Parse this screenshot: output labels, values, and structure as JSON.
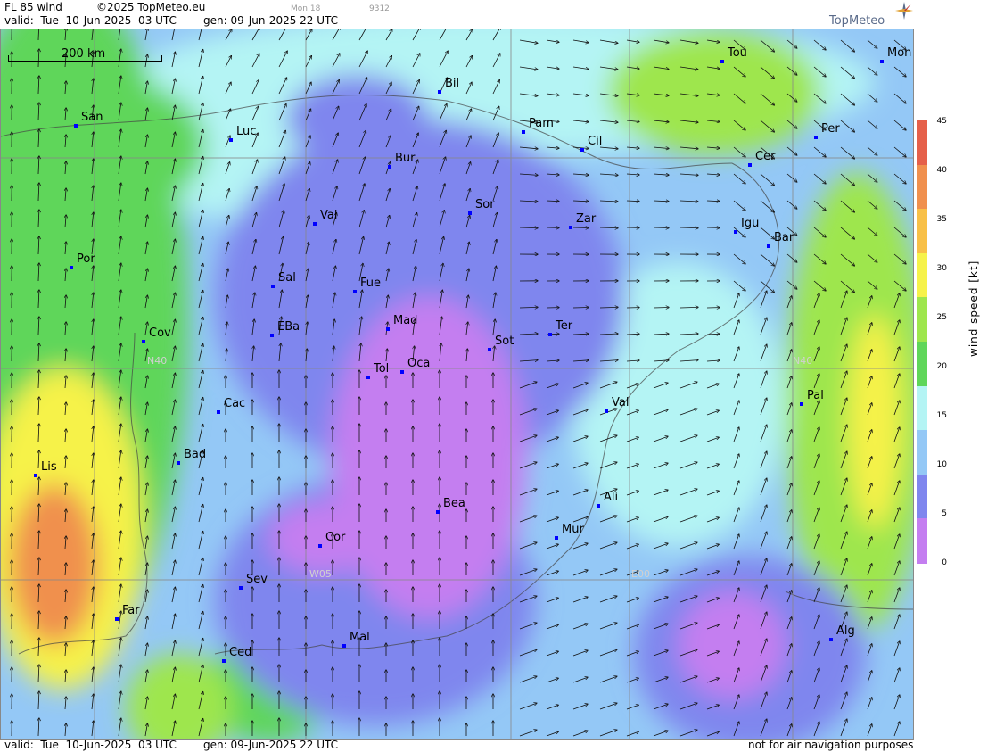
{
  "header": {
    "title": "FL 85 wind",
    "copyright": "©2025 TopMeteo.eu",
    "run_label": "Mon 18",
    "code": "9312",
    "valid": "valid:  Tue  10-Jun-2025  03 UTC",
    "gen": "gen: 09-Jun-2025 22 UTC",
    "brand": "TopMeteo"
  },
  "footer": {
    "valid": "valid:  Tue  10-Jun-2025  03 UTC",
    "gen": "gen: 09-Jun-2025 22 UTC",
    "note": "not for air navigation purposes"
  },
  "scale": {
    "label": "200 km"
  },
  "grid_labels": {
    "lat": "N40",
    "lat_right": "N40",
    "lon_w": "W05",
    "lon_e": "E00"
  },
  "legend": {
    "title": "wind speed [kt]",
    "ticks": [
      "45",
      "40",
      "35",
      "30",
      "25",
      "20",
      "15",
      "10",
      "5",
      "0"
    ],
    "colors": [
      "#e5604a",
      "#f0904e",
      "#f8c048",
      "#f6f24a",
      "#9ee64d",
      "#5fd65a",
      "#b4f4f4",
      "#94c8f6",
      "#7f86ee",
      "#c47ef0"
    ]
  },
  "cities": [
    {
      "name": "Bil"
    },
    {
      "name": "Pam"
    },
    {
      "name": "Cil"
    },
    {
      "name": "Tou"
    },
    {
      "name": "Mon"
    },
    {
      "name": "San"
    },
    {
      "name": "Luc"
    },
    {
      "name": "Bur"
    },
    {
      "name": "Per"
    },
    {
      "name": "Cer"
    },
    {
      "name": "Sor"
    },
    {
      "name": "Val"
    },
    {
      "name": "Zar"
    },
    {
      "name": "Igu"
    },
    {
      "name": "Bar"
    },
    {
      "name": "Por"
    },
    {
      "name": "Sal"
    },
    {
      "name": "Fue"
    },
    {
      "name": "Mad"
    },
    {
      "name": "EBa"
    },
    {
      "name": "Ter"
    },
    {
      "name": "Cov"
    },
    {
      "name": "Sot"
    },
    {
      "name": "Tol"
    },
    {
      "name": "Oca"
    },
    {
      "name": "Cac"
    },
    {
      "name": "Val"
    },
    {
      "name": "Pal"
    },
    {
      "name": "Bad"
    },
    {
      "name": "Lis"
    },
    {
      "name": "Bea"
    },
    {
      "name": "Ali"
    },
    {
      "name": "Cor"
    },
    {
      "name": "Mur"
    },
    {
      "name": "Sev"
    },
    {
      "name": "Far"
    },
    {
      "name": "Mal"
    },
    {
      "name": "Alg"
    },
    {
      "name": "Ced"
    }
  ]
}
